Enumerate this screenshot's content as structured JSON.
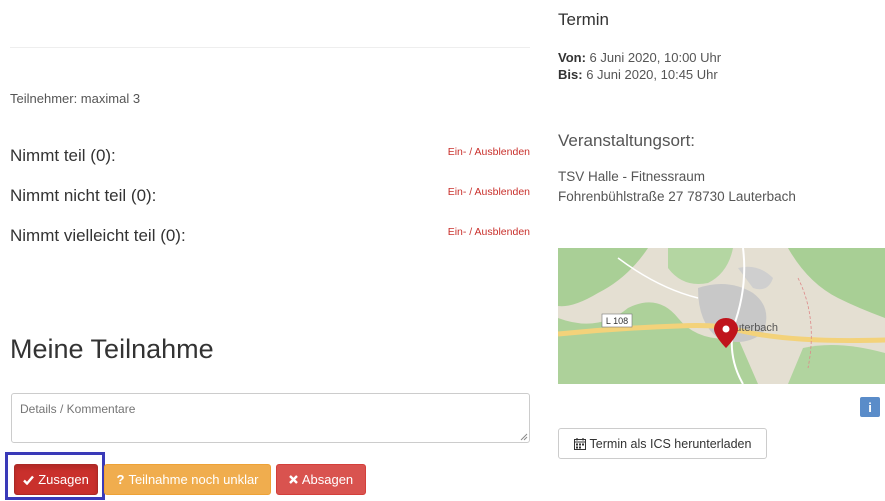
{
  "left": {
    "participants_text": "Teilnehmer: maximal 3",
    "status_rows": [
      {
        "label": "Nimmt teil (0):",
        "link": "Ein- / Ausblenden"
      },
      {
        "label": "Nimmt nicht teil (0):",
        "link": "Ein- / Ausblenden"
      },
      {
        "label": "Nimmt vielleicht teil (0):",
        "link": "Ein- / Ausblenden"
      }
    ],
    "section_title": "Meine Teilnahme",
    "comment_placeholder": "Details / Kommentare",
    "buttons": {
      "accept": "Zusagen",
      "unsure": "Teilnahme noch unklar",
      "decline": "Absagen"
    }
  },
  "right": {
    "title": "Termin",
    "from_label": "Von:",
    "from_value": "6 Juni 2020, 10:00 Uhr",
    "to_label": "Bis:",
    "to_value": "6 Juni 2020, 10:45 Uhr",
    "venue_title": "Veranstaltungsort:",
    "venue_name": "TSV Halle - Fitnessraum",
    "venue_address": "Fohrenbühlstraße 27 78730 Lauterbach",
    "map": {
      "road_label": "L 108",
      "town_label": "Lauterbach"
    },
    "info_glyph": "i",
    "ics_button": "Termin als ICS herunterladen"
  },
  "colors": {
    "danger": "#c9302c",
    "warning": "#f0ad4e",
    "decline": "#d9534f",
    "highlight": "#3a3ab8",
    "info": "#5a8cc9"
  },
  "icons": {
    "accept": "check-icon",
    "unsure": "question-icon",
    "decline": "times-icon",
    "ics": "calendar-icon",
    "map_marker": "map-marker-icon"
  }
}
